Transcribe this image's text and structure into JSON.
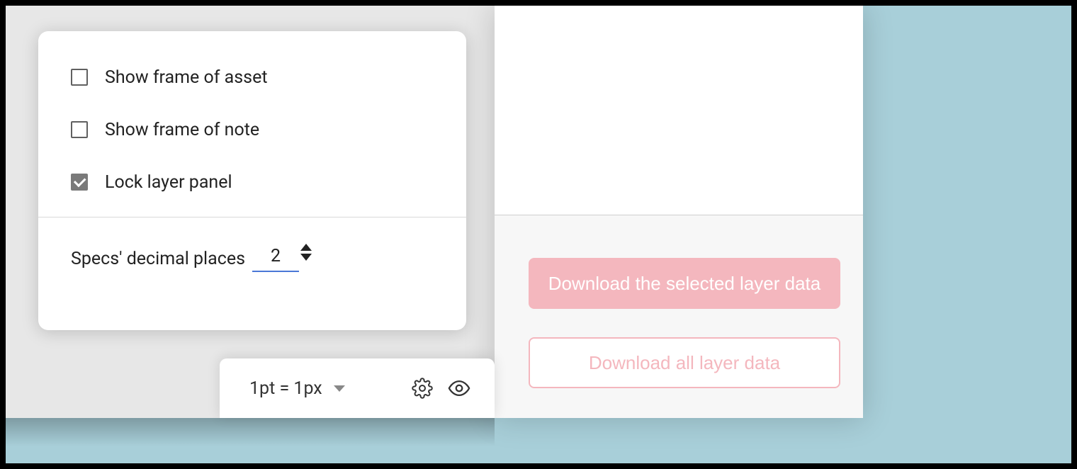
{
  "popover": {
    "options": [
      {
        "label": "Show frame of asset",
        "checked": false
      },
      {
        "label": "Show frame of note",
        "checked": false
      },
      {
        "label": "Lock layer panel",
        "checked": true
      }
    ],
    "decimal_label": "Specs' decimal places",
    "decimal_value": "2"
  },
  "toolbar": {
    "unit_label": "1pt = 1px"
  },
  "right_panel": {
    "download_selected_label": "Download the selected layer data",
    "download_all_label": "Download all layer data"
  }
}
